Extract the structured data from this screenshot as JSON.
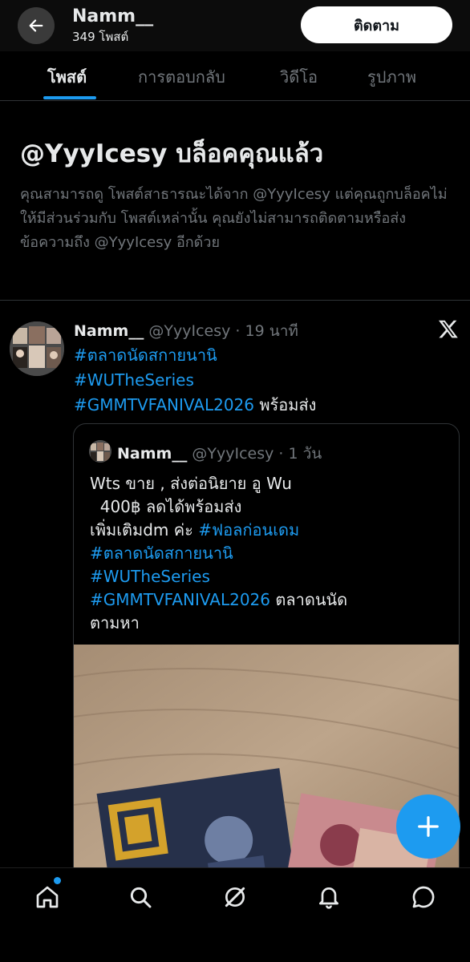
{
  "header": {
    "name": "Namm__",
    "post_count": "349 โพสต์",
    "follow_label": "ติดตาม"
  },
  "tabs": [
    {
      "label": "โพสต์",
      "active": true
    },
    {
      "label": "การตอบกลับ",
      "active": false
    },
    {
      "label": "วิดีโอ",
      "active": false
    },
    {
      "label": "รูปภาพ",
      "active": false
    }
  ],
  "blocked": {
    "title": "@YyyIcesy บล็อคคุณแล้ว",
    "description": "คุณสามารถดู โพสต์สาธารณะได้จาก @YyyIcesy แต่คุณถูกบล็อคไม่ให้มีส่วนร่วมกับ โพสต์เหล่านั้น คุณยังไม่สามารถติดตามหรือส่งข้อความถึง @YyyIcesy อีกด้วย"
  },
  "post": {
    "name": "Namm__",
    "handle": "@YyyIcesy",
    "time": "· 19 นาที",
    "hashtags": [
      "#ตลาดนัดสกายนานิ",
      "#WUTheSeries",
      "#GMMTVFANIVAL2026"
    ],
    "tail_text": " พร้อมส่ง",
    "quote": {
      "name": "Namm__",
      "handle": "@YyyIcesy",
      "time": "· 1 วัน",
      "line1": "Wts ขาย , ส่งต่อนิยาย อู Wu",
      "line2": "  400฿ ลดได้พร้อมส่ง",
      "line3_prefix": "เพิ่มเติมdm ค่ะ ",
      "tag1": "#ฟอลก่อนเดม",
      "tag2": "#ตลาดนัดสกายนานิ",
      "tag3": "#WUTheSeries",
      "tag4": "#GMMTVFANIVAL2026",
      "suffix": " ตลาดนนัด",
      "last_line": "ตามหา"
    }
  },
  "icons": {
    "back": "arrow-left-icon",
    "x_logo": "x-logo-icon",
    "fab": "plus-icon",
    "nav": [
      "home-icon",
      "search-icon",
      "grok-icon",
      "bell-icon",
      "message-icon"
    ]
  },
  "colors": {
    "accent": "#1d9bf0",
    "background": "#000000",
    "muted": "#71767b",
    "text": "#e7e9ea"
  }
}
